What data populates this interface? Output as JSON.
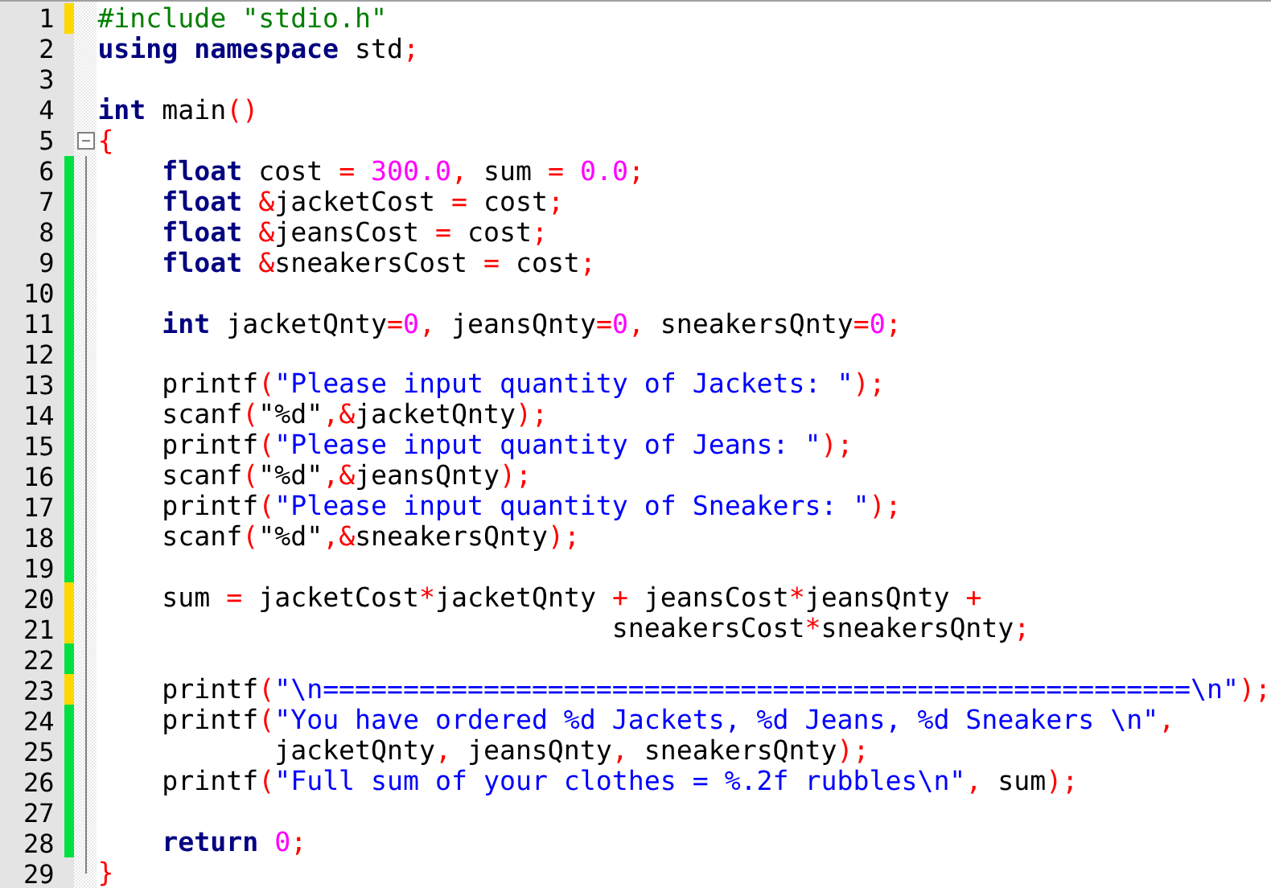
{
  "editor": {
    "lines": [
      {
        "number": "1",
        "color": "#ffd800",
        "tokens": [
          {
            "kind": "pre",
            "text": "#include \"stdio.h\""
          }
        ]
      },
      {
        "number": "2",
        "tokens": [
          {
            "kind": "kw",
            "text": "using namespace"
          },
          {
            "kind": "plain",
            "text": " std"
          },
          {
            "kind": "op",
            "text": ";"
          }
        ]
      },
      {
        "number": "3"
      },
      {
        "number": "4",
        "tokens": [
          {
            "kind": "kw",
            "text": "int"
          },
          {
            "kind": "plain",
            "text": " main"
          },
          {
            "kind": "op",
            "text": "()"
          }
        ]
      },
      {
        "number": "5",
        "kind": "fold-start",
        "tokens": [
          {
            "kind": "op",
            "text": "{"
          }
        ]
      },
      {
        "number": "6",
        "color": "#00e040",
        "kind": "fold-body",
        "tokens": [
          {
            "kind": "kw",
            "text": "    float"
          },
          {
            "kind": "plain",
            "text": " cost "
          },
          {
            "kind": "op",
            "text": "="
          },
          {
            "kind": "num",
            "text": " 300.0"
          },
          {
            "kind": "op",
            "text": ","
          },
          {
            "kind": "plain",
            "text": " sum "
          },
          {
            "kind": "op",
            "text": "="
          },
          {
            "kind": "num",
            "text": " 0.0"
          },
          {
            "kind": "op",
            "text": ";"
          }
        ]
      },
      {
        "number": "7",
        "color": "#00e040",
        "kind": "fold-body",
        "tokens": [
          {
            "kind": "kw",
            "text": "    float"
          },
          {
            "kind": "op",
            "text": " &"
          },
          {
            "kind": "plain",
            "text": "jacketCost "
          },
          {
            "kind": "op",
            "text": "="
          },
          {
            "kind": "plain",
            "text": " cost"
          },
          {
            "kind": "op",
            "text": ";"
          }
        ]
      },
      {
        "number": "8",
        "color": "#00e040",
        "kind": "fold-body",
        "tokens": [
          {
            "kind": "kw",
            "text": "    float"
          },
          {
            "kind": "op",
            "text": " &"
          },
          {
            "kind": "plain",
            "text": "jeansCost "
          },
          {
            "kind": "op",
            "text": "="
          },
          {
            "kind": "plain",
            "text": " cost"
          },
          {
            "kind": "op",
            "text": ";"
          }
        ]
      },
      {
        "number": "9",
        "color": "#00e040",
        "kind": "fold-body",
        "tokens": [
          {
            "kind": "kw",
            "text": "    float"
          },
          {
            "kind": "op",
            "text": " &"
          },
          {
            "kind": "plain",
            "text": "sneakersCost "
          },
          {
            "kind": "op",
            "text": "="
          },
          {
            "kind": "plain",
            "text": " cost"
          },
          {
            "kind": "op",
            "text": ";"
          }
        ]
      },
      {
        "number": "10",
        "color": "#00e040",
        "kind": "fold-body"
      },
      {
        "number": "11",
        "color": "#00e040",
        "kind": "fold-body",
        "tokens": [
          {
            "kind": "kw",
            "text": "    int"
          },
          {
            "kind": "plain",
            "text": " jacketQnty"
          },
          {
            "kind": "op",
            "text": "="
          },
          {
            "kind": "num",
            "text": "0"
          },
          {
            "kind": "op",
            "text": ","
          },
          {
            "kind": "plain",
            "text": " jeansQnty"
          },
          {
            "kind": "op",
            "text": "="
          },
          {
            "kind": "num",
            "text": "0"
          },
          {
            "kind": "op",
            "text": ","
          },
          {
            "kind": "plain",
            "text": " sneakersQnty"
          },
          {
            "kind": "op",
            "text": "="
          },
          {
            "kind": "num",
            "text": "0"
          },
          {
            "kind": "op",
            "text": ";"
          }
        ]
      },
      {
        "number": "12",
        "color": "#00e040",
        "kind": "fold-body"
      },
      {
        "number": "13",
        "color": "#00e040",
        "kind": "fold-body",
        "tokens": [
          {
            "kind": "plain",
            "text": "    printf"
          },
          {
            "kind": "op",
            "text": "("
          },
          {
            "kind": "str",
            "text": "\"Please input quantity of Jackets: \""
          },
          {
            "kind": "op",
            "text": ");"
          }
        ]
      },
      {
        "number": "14",
        "color": "#00e040",
        "kind": "fold-body",
        "tokens": [
          {
            "kind": "plain",
            "text": "    scanf"
          },
          {
            "kind": "op",
            "text": "("
          },
          {
            "kind": "plain",
            "text": "\"%d\""
          },
          {
            "kind": "op",
            "text": ",&"
          },
          {
            "kind": "plain",
            "text": "jacketQnty"
          },
          {
            "kind": "op",
            "text": ");"
          }
        ]
      },
      {
        "number": "15",
        "color": "#00e040",
        "kind": "fold-body",
        "tokens": [
          {
            "kind": "plain",
            "text": "    printf"
          },
          {
            "kind": "op",
            "text": "("
          },
          {
            "kind": "str",
            "text": "\"Please input quantity of Jeans: \""
          },
          {
            "kind": "op",
            "text": ");"
          }
        ]
      },
      {
        "number": "16",
        "color": "#00e040",
        "kind": "fold-body",
        "tokens": [
          {
            "kind": "plain",
            "text": "    scanf"
          },
          {
            "kind": "op",
            "text": "("
          },
          {
            "kind": "plain",
            "text": "\"%d\""
          },
          {
            "kind": "op",
            "text": ",&"
          },
          {
            "kind": "plain",
            "text": "jeansQnty"
          },
          {
            "kind": "op",
            "text": ");"
          }
        ]
      },
      {
        "number": "17",
        "color": "#00e040",
        "kind": "fold-body",
        "tokens": [
          {
            "kind": "plain",
            "text": "    printf"
          },
          {
            "kind": "op",
            "text": "("
          },
          {
            "kind": "str",
            "text": "\"Please input quantity of Sneakers: \""
          },
          {
            "kind": "op",
            "text": ");"
          }
        ]
      },
      {
        "number": "18",
        "color": "#00e040",
        "kind": "fold-body",
        "tokens": [
          {
            "kind": "plain",
            "text": "    scanf"
          },
          {
            "kind": "op",
            "text": "("
          },
          {
            "kind": "plain",
            "text": "\"%d\""
          },
          {
            "kind": "op",
            "text": ",&"
          },
          {
            "kind": "plain",
            "text": "sneakersQnty"
          },
          {
            "kind": "op",
            "text": ");"
          }
        ]
      },
      {
        "number": "19",
        "color": "#00e040",
        "kind": "fold-body"
      },
      {
        "number": "20",
        "color": "#ffd800",
        "kind": "fold-body",
        "tokens": [
          {
            "kind": "plain",
            "text": "    sum "
          },
          {
            "kind": "op",
            "text": "="
          },
          {
            "kind": "plain",
            "text": " jacketCost"
          },
          {
            "kind": "op",
            "text": "*"
          },
          {
            "kind": "plain",
            "text": "jacketQnty "
          },
          {
            "kind": "op",
            "text": "+"
          },
          {
            "kind": "plain",
            "text": " jeansCost"
          },
          {
            "kind": "op",
            "text": "*"
          },
          {
            "kind": "plain",
            "text": "jeansQnty "
          },
          {
            "kind": "op",
            "text": "+"
          }
        ]
      },
      {
        "number": "21",
        "color": "#ffd800",
        "kind": "fold-body",
        "tokens": [
          {
            "kind": "plain",
            "text": "                                sneakersCost"
          },
          {
            "kind": "op",
            "text": "*"
          },
          {
            "kind": "plain",
            "text": "sneakersQnty"
          },
          {
            "kind": "op",
            "text": ";"
          }
        ]
      },
      {
        "number": "22",
        "color": "#00e040",
        "kind": "fold-body"
      },
      {
        "number": "23",
        "color": "#ffd800",
        "kind": "fold-body",
        "tokens": [
          {
            "kind": "plain",
            "text": "    printf"
          },
          {
            "kind": "op",
            "text": "("
          },
          {
            "kind": "str",
            "text": "\"\\n======================================================\\n\""
          },
          {
            "kind": "op",
            "text": ");"
          }
        ]
      },
      {
        "number": "24",
        "color": "#00e040",
        "kind": "fold-body",
        "tokens": [
          {
            "kind": "plain",
            "text": "    printf"
          },
          {
            "kind": "op",
            "text": "("
          },
          {
            "kind": "str",
            "text": "\"You have ordered %d Jackets, %d Jeans, %d Sneakers \\n\""
          },
          {
            "kind": "op",
            "text": ","
          }
        ]
      },
      {
        "number": "25",
        "color": "#00e040",
        "kind": "fold-body",
        "tokens": [
          {
            "kind": "plain",
            "text": "           jacketQnty"
          },
          {
            "kind": "op",
            "text": ","
          },
          {
            "kind": "plain",
            "text": " jeansQnty"
          },
          {
            "kind": "op",
            "text": ","
          },
          {
            "kind": "plain",
            "text": " sneakersQnty"
          },
          {
            "kind": "op",
            "text": ");"
          }
        ]
      },
      {
        "number": "26",
        "color": "#00e040",
        "kind": "fold-body",
        "tokens": [
          {
            "kind": "plain",
            "text": "    printf"
          },
          {
            "kind": "op",
            "text": "("
          },
          {
            "kind": "str",
            "text": "\"Full sum of your clothes = %.2f rubbles\\n\""
          },
          {
            "kind": "op",
            "text": ","
          },
          {
            "kind": "plain",
            "text": " sum"
          },
          {
            "kind": "op",
            "text": ");"
          }
        ]
      },
      {
        "number": "27",
        "color": "#00e040",
        "kind": "fold-body"
      },
      {
        "number": "28",
        "color": "#00e040",
        "kind": "fold-body",
        "tokens": [
          {
            "kind": "kw",
            "text": "    return"
          },
          {
            "kind": "num",
            "text": " 0"
          },
          {
            "kind": "op",
            "text": ";"
          }
        ]
      },
      {
        "number": "29",
        "kind": "fold-end",
        "tokens": [
          {
            "kind": "op",
            "text": "}"
          }
        ]
      }
    ]
  }
}
